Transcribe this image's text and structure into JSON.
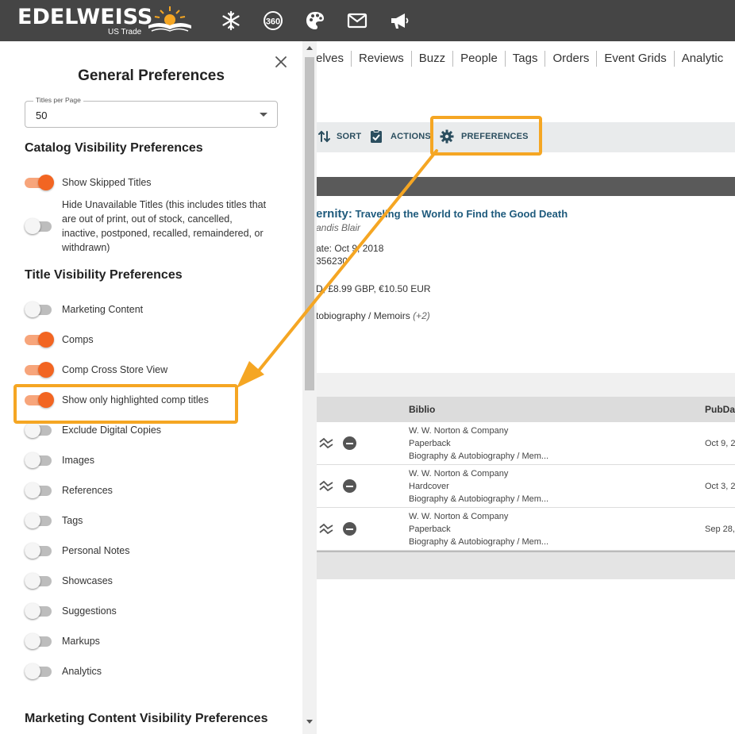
{
  "header": {
    "logo_text": "EDELWEISS",
    "logo_subtitle": "US Trade",
    "icons": [
      "snowflake-icon",
      "360-icon",
      "palette-icon",
      "mail-icon",
      "megaphone-icon"
    ]
  },
  "nav": {
    "items": [
      "elves",
      "Reviews",
      "Buzz",
      "People",
      "Tags",
      "Orders",
      "Event Grids",
      "Analytic"
    ]
  },
  "toolbar": {
    "sort_label": "SORT",
    "actions_label": "ACTIONS",
    "preferences_label": "PREFERENCES"
  },
  "book": {
    "title_prefix": "ernity:",
    "title_rest": " Traveling the World to Find the Good Death",
    "author": "andis Blair",
    "date": "ate: Oct 9, 2018",
    "isbn": "356230",
    "price": "D, £8.99 GBP, €10.50 EUR",
    "category": "tobiography / Memoirs",
    "category_more": "(+2)"
  },
  "table": {
    "columns": [
      "Biblio",
      "PubDa"
    ],
    "rows": [
      {
        "publisher": "W. W. Norton & Company",
        "format": "Paperback",
        "category": "Biography & Autobiography / Mem...",
        "date": "Oct 9, 2"
      },
      {
        "publisher": "W. W. Norton & Company",
        "format": "Hardcover",
        "category": "Biography & Autobiography / Mem...",
        "date": "Oct 3, 2"
      },
      {
        "publisher": "W. W. Norton & Company",
        "format": "Paperback",
        "category": "Biography & Autobiography / Mem...",
        "date": "Sep 28,"
      }
    ]
  },
  "panel": {
    "title": "General Preferences",
    "titles_per_page": {
      "label": "Titles per Page",
      "value": "50"
    },
    "catalog_section": "Catalog Visibility Preferences",
    "catalog_toggles": [
      {
        "label": "Show Skipped Titles",
        "on": true
      },
      {
        "label": "Hide Unavailable Titles (this includes titles that are out of print, out of stock, cancelled, inactive, postponed, recalled, remaindered, or withdrawn)",
        "on": false
      }
    ],
    "title_section": "Title Visibility Preferences",
    "title_toggles": [
      {
        "label": "Marketing Content",
        "on": false
      },
      {
        "label": "Comps",
        "on": true
      },
      {
        "label": "Comp Cross Store View",
        "on": true
      },
      {
        "label": "Show only highlighted comp titles",
        "on": true
      },
      {
        "label": "Exclude Digital Copies",
        "on": false
      },
      {
        "label": "Images",
        "on": false
      },
      {
        "label": "References",
        "on": false
      },
      {
        "label": "Tags",
        "on": false
      },
      {
        "label": "Personal Notes",
        "on": false
      },
      {
        "label": "Showcases",
        "on": false
      },
      {
        "label": "Suggestions",
        "on": false
      },
      {
        "label": "Markups",
        "on": false
      },
      {
        "label": "Analytics",
        "on": false
      }
    ],
    "marketing_section": "Marketing Content Visibility Preferences"
  },
  "colors": {
    "header_bg": "#454545",
    "toggle_on": "#f26522",
    "toggle_on_track": "#f7a57b",
    "toggle_off_track": "#bdbdbd",
    "annotation": "#f5a623",
    "link": "#1e5a7c"
  }
}
